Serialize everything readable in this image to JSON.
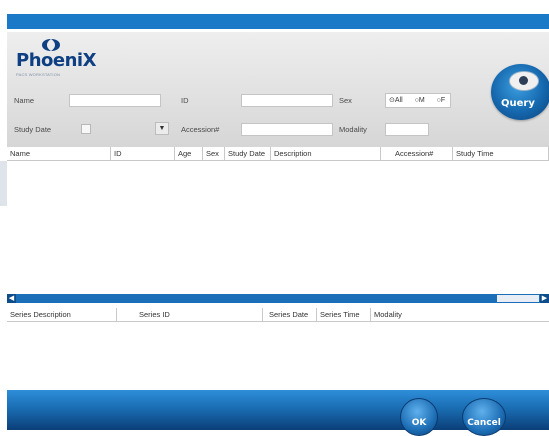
{
  "brand": {
    "name": "PhoeniX",
    "tagline": "PACS WORKSTATION",
    "accent": "#1a7ac7"
  },
  "search": {
    "name_label": "Name",
    "id_label": "ID",
    "sex_label": "Sex",
    "study_date_label": "Study Date",
    "accession_label": "Accession#",
    "modality_label": "Modality",
    "name_value": "",
    "id_value": "",
    "accession_value": "",
    "modality_value": "",
    "study_date_value": "",
    "dropdown_icon": "chevron-down-icon",
    "sex_options": [
      "All",
      "M",
      "F"
    ],
    "sex_selected": "All",
    "query_label": "Query"
  },
  "study_table": {
    "columns": [
      "Name",
      "ID",
      "Age",
      "Sex",
      "Study Date",
      "Description",
      "Accession#",
      "Study Time"
    ],
    "rows": []
  },
  "series_table": {
    "columns": [
      "Series Description",
      "Series ID",
      "Series Date",
      "Series Time",
      "Modality"
    ],
    "rows": []
  },
  "footer": {
    "ok_label": "OK",
    "cancel_label": "Cancel"
  }
}
